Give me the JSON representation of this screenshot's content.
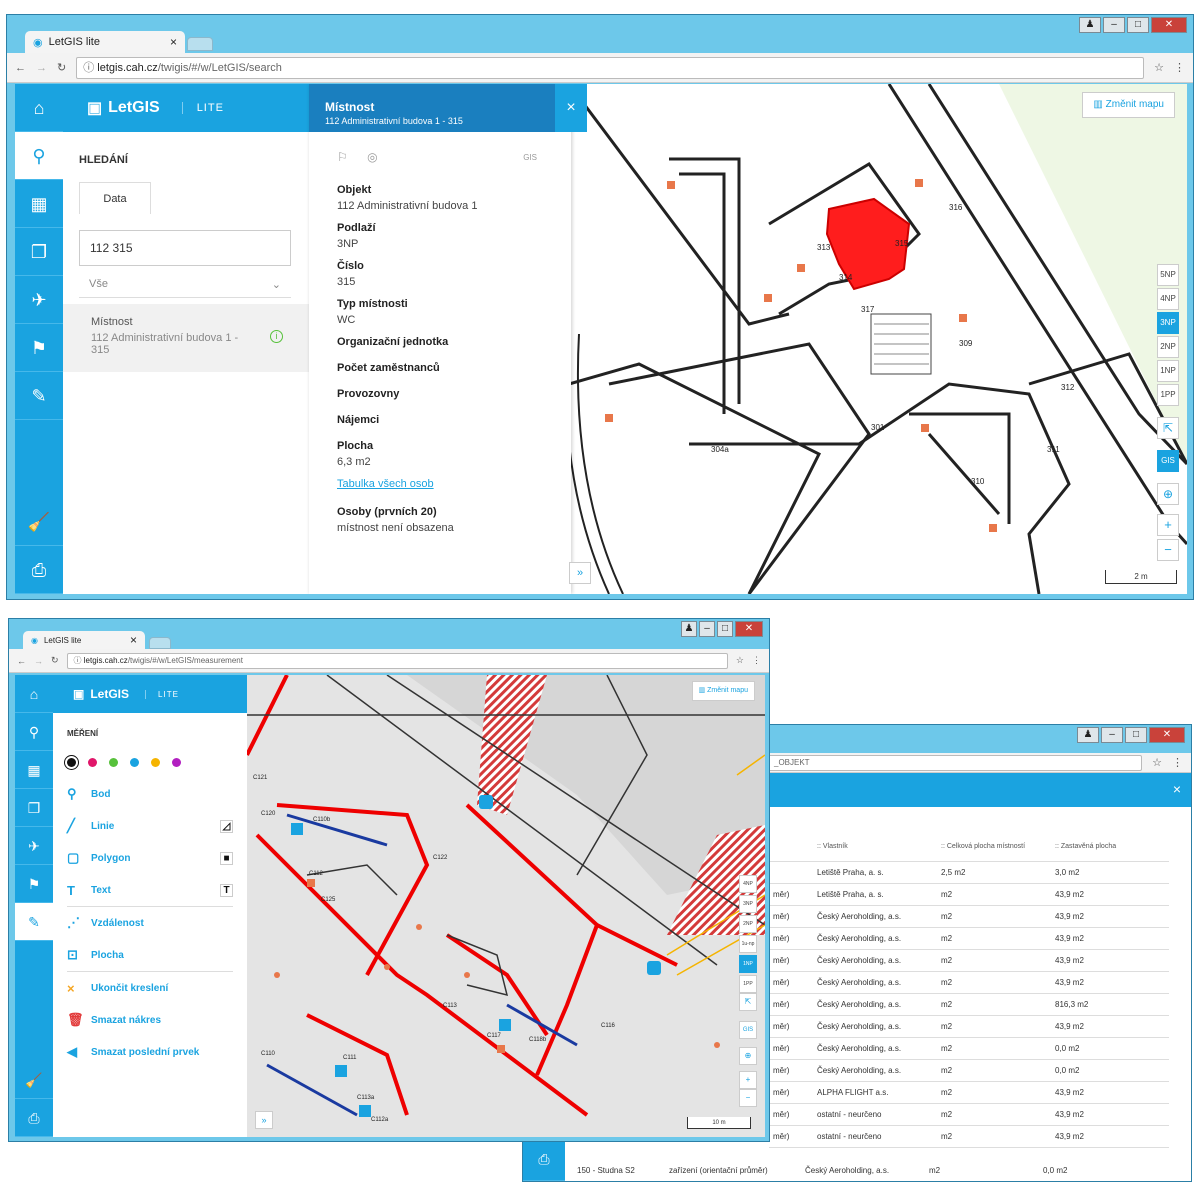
{
  "window1": {
    "tab": "LetGIS lite",
    "tab_close": "×",
    "url_prefix": "letgis.cah.cz",
    "url_rest": "/twigis/#/w/LetGIS/search",
    "brand": "LetGIS",
    "lite": "LITE",
    "search_title": "HLEDÁNÍ",
    "data_tab": "Data",
    "search_value": "112 315",
    "filter": "Vše",
    "result": {
      "title": "Místnost",
      "subtitle": "112 Administrativní budova 1 - 315"
    },
    "detail": {
      "header_title": "Místnost",
      "header_subtitle": "112 Administrativní budova 1 - 315",
      "close": "×",
      "gis": "GIS",
      "fields": [
        {
          "label": "Objekt",
          "value": "112 Administrativní budova 1"
        },
        {
          "label": "Podlaží",
          "value": "3NP"
        },
        {
          "label": "Číslo",
          "value": "315"
        },
        {
          "label": "Typ místnosti",
          "value": "WC"
        },
        {
          "label": "Organizační jednotka",
          "value": ""
        },
        {
          "label": "Počet zaměstnanců",
          "value": ""
        },
        {
          "label": "Provozovny",
          "value": ""
        },
        {
          "label": "Nájemci",
          "value": ""
        },
        {
          "label": "Plocha",
          "value": "6,3 m2"
        }
      ],
      "link": "Tabulka všech osob",
      "persons_label": "Osoby (prvních 20)",
      "persons_value": "místnost není obsazena"
    },
    "change_map": "Změnit mapu",
    "floors": [
      "5NP",
      "4NP",
      "3NP",
      "2NP",
      "1NP",
      "1PP"
    ],
    "active_floor": "3NP",
    "zoom_in": "+",
    "zoom_out": "−",
    "scale": "2 m",
    "expand": "»",
    "room_labels": [
      "316",
      "313",
      "315",
      "314",
      "317",
      "309",
      "312",
      "301",
      "304a",
      "311",
      "310"
    ]
  },
  "window2": {
    "tab": "LetGIS lite",
    "tab_close": "×",
    "url_prefix": "letgis.cah.cz",
    "url_rest": "/twigis/#/w/LetGIS/measurement",
    "brand": "LetGIS",
    "lite": "LITE",
    "title": "MĚŘENÍ",
    "colors": [
      "#111111",
      "#e0166a",
      "#57c13b",
      "#1aa3e0",
      "#f5b400",
      "#b21fc0"
    ],
    "tools": [
      {
        "label": "Bod",
        "icon": "marker"
      },
      {
        "label": "Linie",
        "icon": "line"
      },
      {
        "label": "Polygon",
        "icon": "square"
      },
      {
        "label": "Text",
        "icon": "text"
      }
    ],
    "measures": [
      {
        "label": "Vzdálenost"
      },
      {
        "label": "Plocha"
      }
    ],
    "actions": [
      {
        "label": "Ukončit kreslení",
        "icon": "×",
        "color": "#f5a623"
      },
      {
        "label": "Smazat nákres",
        "icon": "🗑",
        "color": "#e23b3b"
      },
      {
        "label": "Smazat poslední prvek",
        "icon": "◀",
        "color": "#1aa3e0"
      }
    ],
    "change_map": "Změnit mapu",
    "floors": [
      "4NP",
      "3NP",
      "2NP",
      "1u-np",
      "1NP",
      "1PP"
    ],
    "active_floor": "1NP",
    "scale": "10 m",
    "collapse": "‹",
    "expand": "»",
    "labels": [
      "C121",
      "C110b",
      "C120",
      "C125",
      "C112",
      "C122",
      "C113",
      "C117",
      "C118b",
      "C116",
      "C110",
      "C111",
      "C113a",
      "C112a"
    ]
  },
  "window3": {
    "url_rest": "_OBJEKT",
    "close": "×",
    "headers": [
      "Vlastník",
      "Celková plocha místností",
      "Zastavěná plocha"
    ],
    "rows": [
      {
        "type": "",
        "owner": "Letiště Praha, a. s.",
        "total": "2,5 m2",
        "built": "3,0 m2"
      },
      {
        "type": "měr)",
        "owner": "Letiště Praha, a. s.",
        "total": "m2",
        "built": "43,9 m2"
      },
      {
        "type": "měr)",
        "owner": "Český Aeroholding, a.s.",
        "total": "m2",
        "built": "43,9 m2"
      },
      {
        "type": "měr)",
        "owner": "Český Aeroholding, a.s.",
        "total": "m2",
        "built": "43,9 m2"
      },
      {
        "type": "měr)",
        "owner": "Český Aeroholding, a.s.",
        "total": "m2",
        "built": "43,9 m2"
      },
      {
        "type": "měr)",
        "owner": "Český Aeroholding, a.s.",
        "total": "m2",
        "built": "43,9 m2"
      },
      {
        "type": "měr)",
        "owner": "Český Aeroholding, a.s.",
        "total": "m2",
        "built": "816,3 m2"
      },
      {
        "type": "měr)",
        "owner": "Český Aeroholding, a.s.",
        "total": "m2",
        "built": "43,9 m2"
      },
      {
        "type": "měr)",
        "owner": "Český Aeroholding, a.s.",
        "total": "m2",
        "built": "0,0 m2"
      },
      {
        "type": "měr)",
        "owner": "Český Aeroholding, a.s.",
        "total": "m2",
        "built": "0,0 m2"
      },
      {
        "type": "měr)",
        "owner": "ALPHA FLIGHT a.s.",
        "total": "m2",
        "built": "43,9 m2"
      },
      {
        "type": "měr)",
        "owner": "ostatní - neurčeno",
        "total": "m2",
        "built": "43,9 m2"
      },
      {
        "type": "měr)",
        "owner": "ostatní - neurčeno",
        "total": "m2",
        "built": "43,9 m2"
      }
    ],
    "last_row": {
      "name": "150 - Studna S2",
      "type": "zařízení (orientační průměr)",
      "owner": "Český Aeroholding, a.s.",
      "total": "m2",
      "built": "0,0 m2"
    }
  }
}
